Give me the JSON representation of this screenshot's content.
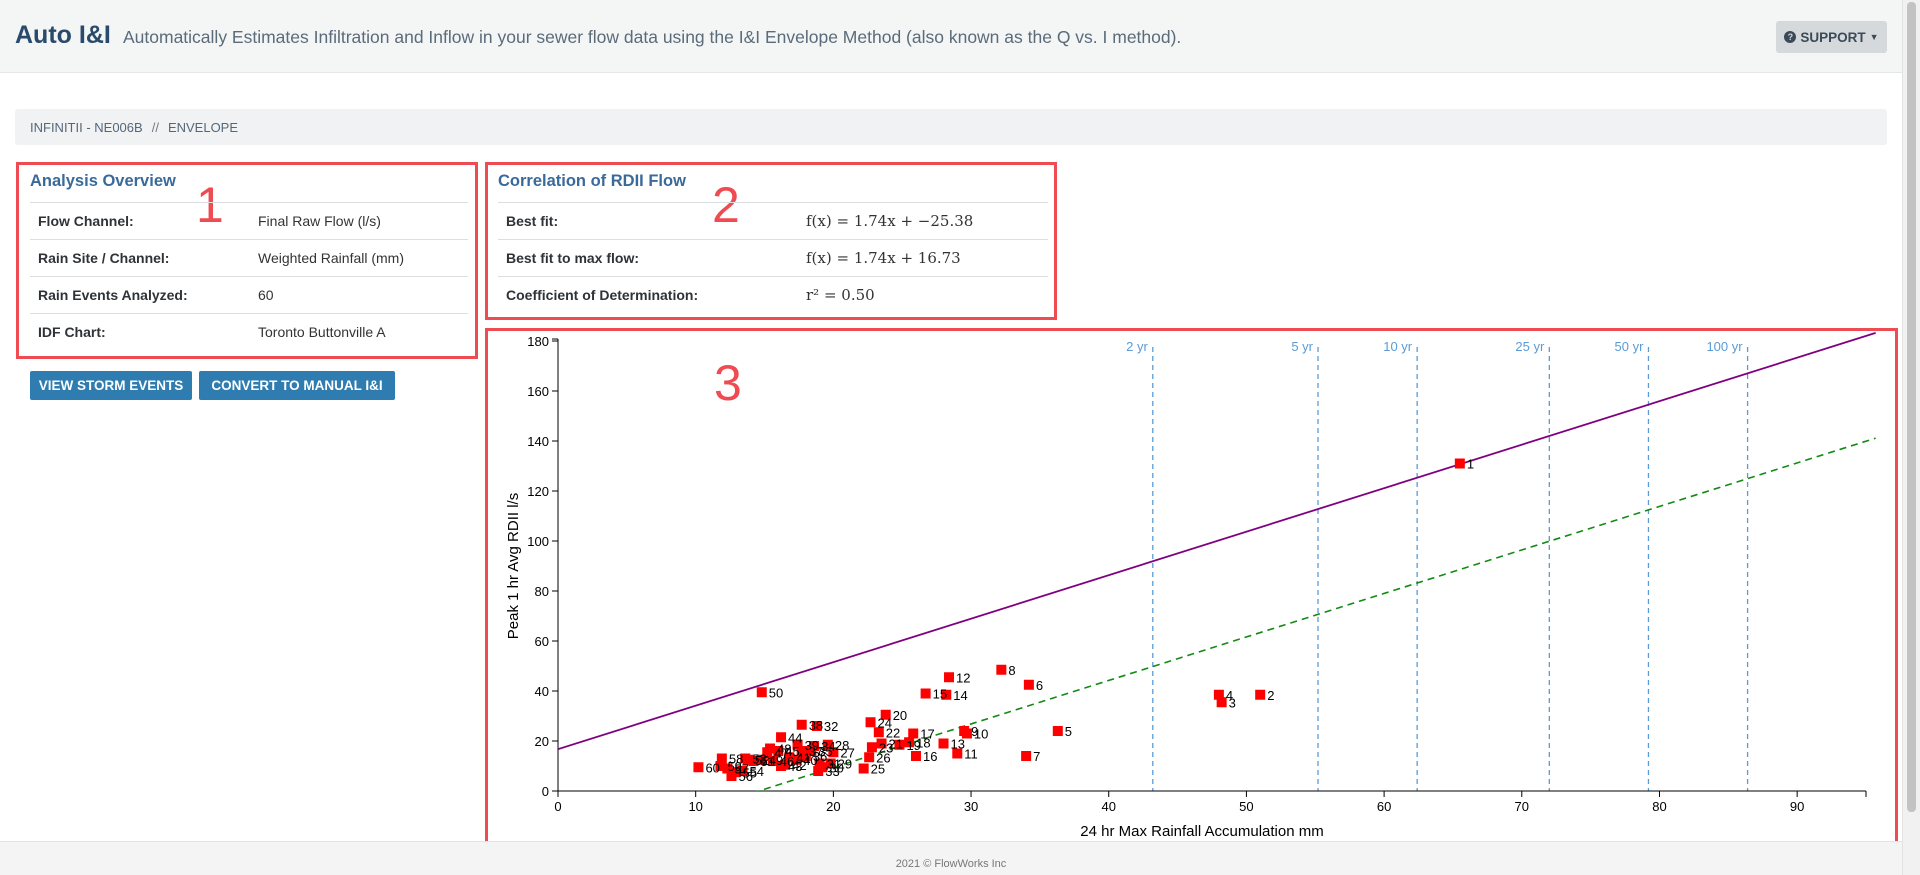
{
  "header": {
    "brand": "Auto I&I",
    "tagline": "Automatically Estimates Infiltration and Inflow in your sewer flow data using the I&I Envelope Method (also known as the Q vs. I method).",
    "support_label": "SUPPORT"
  },
  "breadcrumb": {
    "site": "INFINITII - NE006B",
    "separator": "//",
    "page": "ENVELOPE"
  },
  "annotations": {
    "box1": "1",
    "box2": "2",
    "box3": "3"
  },
  "analysis_overview": {
    "title": "Analysis Overview",
    "rows": [
      {
        "label": "Flow Channel:",
        "value": "Final Raw Flow (l/s)"
      },
      {
        "label": "Rain Site / Channel:",
        "value": "Weighted Rainfall (mm)"
      },
      {
        "label": "Rain Events Analyzed:",
        "value": "60"
      },
      {
        "label": "IDF Chart:",
        "value": "Toronto Buttonville A"
      }
    ]
  },
  "correlation": {
    "title": "Correlation of RDII Flow",
    "rows": [
      {
        "label": "Best fit:",
        "value": "f(x) = 1.74x + −25.38"
      },
      {
        "label": "Best fit to max flow:",
        "value": "f(x) = 1.74x + 16.73"
      },
      {
        "label": "Coefficient of Determination:",
        "value": "r² = 0.50"
      }
    ]
  },
  "buttons": {
    "view_storm_events": "VIEW STORM EVENTS",
    "convert_manual": "CONVERT TO MANUAL I&I"
  },
  "footer": {
    "text": "2021 © FlowWorks Inc"
  },
  "chart_data": {
    "type": "scatter",
    "xlabel": "24 hr Max Rainfall Accumulation mm",
    "ylabel": "Peak 1 hr Avg RDII l/s",
    "xlim": [
      0,
      95
    ],
    "ylim": [
      0,
      180
    ],
    "xticks": [
      0,
      10,
      20,
      30,
      40,
      50,
      60,
      70,
      80,
      90
    ],
    "yticks": [
      0,
      20,
      40,
      60,
      80,
      100,
      120,
      140,
      160,
      180
    ],
    "marker_color": "#ff0000",
    "points": [
      {
        "label": "1",
        "x": 65.5,
        "y": 131
      },
      {
        "label": "2",
        "x": 51.0,
        "y": 38.5
      },
      {
        "label": "3",
        "x": 48.2,
        "y": 35.5
      },
      {
        "label": "4",
        "x": 48.0,
        "y": 38.5
      },
      {
        "label": "5",
        "x": 36.3,
        "y": 24
      },
      {
        "label": "6",
        "x": 34.2,
        "y": 42.5
      },
      {
        "label": "7",
        "x": 34.0,
        "y": 14
      },
      {
        "label": "8",
        "x": 32.2,
        "y": 48.5
      },
      {
        "label": "9",
        "x": 29.5,
        "y": 24
      },
      {
        "label": "10",
        "x": 29.7,
        "y": 23
      },
      {
        "label": "11",
        "x": 29.0,
        "y": 15
      },
      {
        "label": "12",
        "x": 28.4,
        "y": 45.5
      },
      {
        "label": "13",
        "x": 28.0,
        "y": 19
      },
      {
        "label": "14",
        "x": 28.2,
        "y": 38.5
      },
      {
        "label": "15",
        "x": 26.7,
        "y": 39
      },
      {
        "label": "16",
        "x": 26.0,
        "y": 14
      },
      {
        "label": "17",
        "x": 25.8,
        "y": 23
      },
      {
        "label": "18",
        "x": 25.5,
        "y": 19.5
      },
      {
        "label": "19",
        "x": 24.8,
        "y": 18.5
      },
      {
        "label": "20",
        "x": 23.8,
        "y": 30.5
      },
      {
        "label": "21",
        "x": 23.5,
        "y": 19
      },
      {
        "label": "22",
        "x": 23.3,
        "y": 23.5
      },
      {
        "label": "23",
        "x": 22.8,
        "y": 17.5
      },
      {
        "label": "24",
        "x": 22.7,
        "y": 27.5
      },
      {
        "label": "25",
        "x": 22.2,
        "y": 9
      },
      {
        "label": "26",
        "x": 22.6,
        "y": 13.5
      },
      {
        "label": "27",
        "x": 20.0,
        "y": 15.5
      },
      {
        "label": "28",
        "x": 19.6,
        "y": 18.5
      },
      {
        "label": "29",
        "x": 19.8,
        "y": 11
      },
      {
        "label": "30",
        "x": 19.2,
        "y": 9.5
      },
      {
        "label": "31",
        "x": 19.0,
        "y": 11
      },
      {
        "label": "32",
        "x": 18.8,
        "y": 26
      },
      {
        "label": "33",
        "x": 18.9,
        "y": 8
      },
      {
        "label": "34",
        "x": 18.6,
        "y": 18
      },
      {
        "label": "35",
        "x": 18.4,
        "y": 16
      },
      {
        "label": "36",
        "x": 18.0,
        "y": 14
      },
      {
        "label": "37",
        "x": 17.7,
        "y": 16
      },
      {
        "label": "38",
        "x": 17.7,
        "y": 26.5
      },
      {
        "label": "39",
        "x": 17.4,
        "y": 18.5
      },
      {
        "label": "40",
        "x": 17.3,
        "y": 12.5
      },
      {
        "label": "41",
        "x": 16.8,
        "y": 13.5
      },
      {
        "label": "42",
        "x": 16.5,
        "y": 10.5
      },
      {
        "label": "43",
        "x": 16.2,
        "y": 10
      },
      {
        "label": "44",
        "x": 16.2,
        "y": 21.5
      },
      {
        "label": "45",
        "x": 16.0,
        "y": 16
      },
      {
        "label": "46",
        "x": 15.6,
        "y": 12
      },
      {
        "label": "47",
        "x": 15.2,
        "y": 15.5
      },
      {
        "label": "48",
        "x": 15.4,
        "y": 17
      },
      {
        "label": "49",
        "x": 14.8,
        "y": 12.5
      },
      {
        "label": "50",
        "x": 14.8,
        "y": 39.5
      },
      {
        "label": "51",
        "x": 14.2,
        "y": 12
      },
      {
        "label": "52",
        "x": 13.8,
        "y": 12.5
      },
      {
        "label": "53",
        "x": 13.6,
        "y": 13
      },
      {
        "label": "54",
        "x": 13.4,
        "y": 8
      },
      {
        "label": "55",
        "x": 12.9,
        "y": 7.5
      },
      {
        "label": "56",
        "x": 12.6,
        "y": 6
      },
      {
        "label": "57",
        "x": 12.3,
        "y": 9
      },
      {
        "label": "58",
        "x": 11.9,
        "y": 13
      },
      {
        "label": "59",
        "x": 11.8,
        "y": 10
      },
      {
        "label": "60",
        "x": 10.2,
        "y": 9.5
      }
    ],
    "lines": [
      {
        "name": "Best fit to max flow",
        "slope": 1.74,
        "intercept": 16.73,
        "style": "solid",
        "color": "#800080"
      },
      {
        "name": "Best fit",
        "slope": 1.74,
        "intercept": -25.38,
        "style": "dashed",
        "color": "#138a13"
      }
    ],
    "return_periods": [
      {
        "label": "2 yr",
        "x": 43.2
      },
      {
        "label": "5 yr",
        "x": 55.2
      },
      {
        "label": "10 yr",
        "x": 62.4
      },
      {
        "label": "25 yr",
        "x": 72.0
      },
      {
        "label": "50 yr",
        "x": 79.2
      },
      {
        "label": "100 yr",
        "x": 86.4
      }
    ],
    "return_period_color": "#5b9bd5"
  }
}
